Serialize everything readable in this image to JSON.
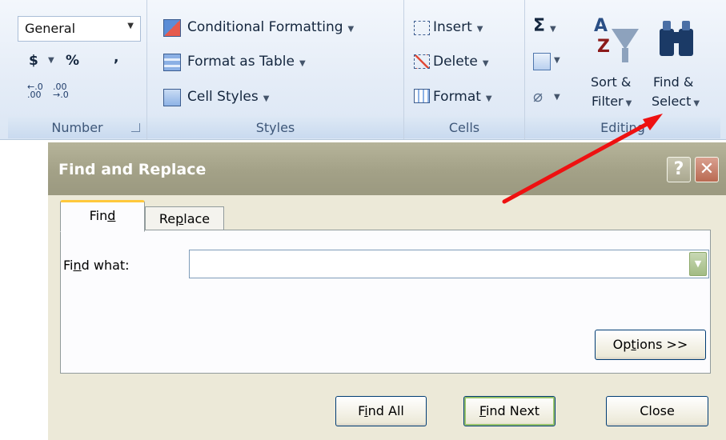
{
  "ribbon": {
    "number": {
      "format_value": "General",
      "currency_symbol": "$",
      "percent_symbol": "%",
      "comma_symbol": ",",
      "group_label": "Number"
    },
    "styles": {
      "conditional_formatting": "Conditional Formatting",
      "format_as_table": "Format as Table",
      "cell_styles": "Cell Styles",
      "group_label": "Styles"
    },
    "cells": {
      "insert": "Insert",
      "delete": "Delete",
      "format": "Format",
      "group_label": "Cells"
    },
    "editing": {
      "sigma": "Σ",
      "sort_filter_line1": "Sort &",
      "sort_filter_line2": "Filter",
      "find_select_line1": "Find &",
      "find_select_line2": "Select",
      "group_label": "Editing"
    }
  },
  "dialog": {
    "title": "Find and Replace",
    "help_button": "?",
    "close_button": "✕",
    "tabs": [
      {
        "label_pre": "Fin",
        "label_key": "d",
        "label_post": ""
      },
      {
        "label_pre": "Re",
        "label_key": "p",
        "label_post": "lace"
      }
    ],
    "find_what_pre": "Fi",
    "find_what_key": "n",
    "find_what_post": "d what:",
    "find_what_value": "",
    "options_pre": "Op",
    "options_key": "t",
    "options_post": "ions >>",
    "find_all_pre": "F",
    "find_all_key": "i",
    "find_all_post": "nd All",
    "find_next_key": "F",
    "find_next_post": "ind Next",
    "close_label": "Close"
  },
  "annotation": {
    "arrow_color": "#ee1111"
  }
}
